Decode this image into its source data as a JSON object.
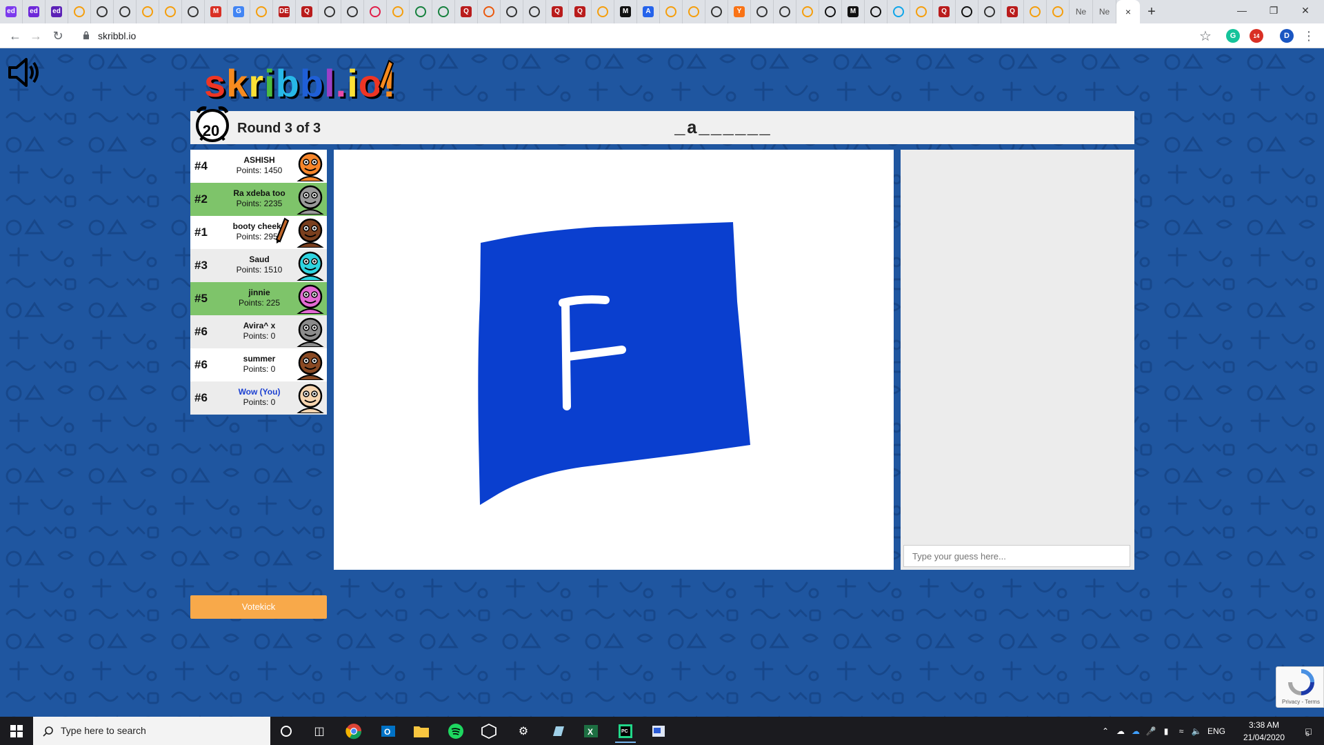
{
  "browser": {
    "tabs": [
      "ed",
      "ed",
      "ed",
      "",
      "",
      "",
      "",
      "",
      "",
      "M",
      "G",
      "",
      "DE",
      "Q",
      "",
      "",
      "",
      "",
      "",
      "",
      "Q",
      "",
      "",
      "",
      "Q",
      "Q",
      "",
      "M",
      "A",
      "",
      "",
      "",
      "Y",
      "",
      "",
      "",
      "",
      "M",
      "",
      "",
      "",
      "Q",
      "",
      "",
      "Q",
      "",
      "",
      "Ne",
      "Ne"
    ],
    "active_tab_close": "×",
    "new_tab": "+",
    "url": "skribbl.io",
    "profile_initial": "D",
    "extension_badge": "14"
  },
  "game": {
    "logo": "skribbl.io",
    "timer": "20",
    "round": "Round 3 of 3",
    "word_hint": "_a______",
    "votekick_label": "Votekick",
    "guess_placeholder": "Type your guess here...",
    "players": [
      {
        "rank": "#4",
        "name": "ASHISH",
        "points": "Points: 1450",
        "state": "odd",
        "avatar_color": "#f5852a",
        "you": false,
        "drawing": false
      },
      {
        "rank": "#2",
        "name": "Ra xdeba too",
        "points": "Points: 2235",
        "state": "guessed",
        "avatar_color": "#9a9a9a",
        "you": false,
        "drawing": false
      },
      {
        "rank": "#1",
        "name": "booty cheeks",
        "points": "Points: 2950",
        "state": "odd",
        "avatar_color": "#7a3f1e",
        "you": false,
        "drawing": true
      },
      {
        "rank": "#3",
        "name": "Saud",
        "points": "Points: 1510",
        "state": "even",
        "avatar_color": "#2fd4e0",
        "you": false,
        "drawing": false
      },
      {
        "rank": "#5",
        "name": "jinnie",
        "points": "Points: 225",
        "state": "guessed",
        "avatar_color": "#e36ad3",
        "you": false,
        "drawing": false
      },
      {
        "rank": "#6",
        "name": "Avira^  x",
        "points": "Points: 0",
        "state": "even",
        "avatar_color": "#8c8c8c",
        "you": false,
        "drawing": false
      },
      {
        "rank": "#6",
        "name": "summer",
        "points": "Points: 0",
        "state": "odd",
        "avatar_color": "#8a4a24",
        "you": false,
        "drawing": false
      },
      {
        "rank": "#6",
        "name": "Wow (You)",
        "points": "Points: 0",
        "state": "even",
        "avatar_color": "#f6d5b0",
        "you": true,
        "drawing": false
      }
    ],
    "drawing_fill": "#0a3fcf"
  },
  "recaptcha": {
    "text": "Privacy - Terms"
  },
  "taskbar": {
    "search_placeholder": "Type here to search",
    "language": "ENG",
    "time": "3:38 AM",
    "date": "21/04/2020",
    "notifications": "5"
  },
  "colors": {
    "background": "#1f56a0",
    "guessed_row": "#7ec46a",
    "votekick": "#f8a94a"
  }
}
